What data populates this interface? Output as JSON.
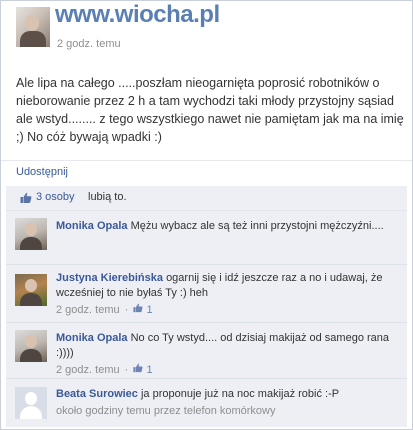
{
  "post": {
    "author": "",
    "time": "2 godz. temu",
    "text": "Ale lipa na całego .....poszłam nieogarnięta poprosić robotników o nieborowanie przez 2 h a tam wychodzi taki młody przystojny sąsiad ale wstyd........ z tego wszystkiego nawet nie pamiętam jak ma na imię ;) No cóż bywają wpadki :)",
    "share_label": "Udostępnij",
    "watermark": "www.wiocha.pl"
  },
  "likes": {
    "icon": "thumbs-up-icon",
    "count_label": "3 osoby",
    "suffix": "lubią to."
  },
  "comments": [
    {
      "author": "Monika Opala",
      "text": "Mężu wybacz ale są też inni przystojni mężczyźni....",
      "time": "",
      "likes": ""
    },
    {
      "author": "Justyna Kierebińska",
      "text": "ogarnij się i idź jeszcze raz a no i udawaj, że wcześniej to nie byłaś Ty :) heh",
      "time": "2 godz. temu",
      "likes": "1"
    },
    {
      "author": "Monika Opala",
      "text": "No co Ty wstyd.... od dzisiaj makijaż od samego rana :))))",
      "time": "2 godz. temu",
      "likes": "1"
    },
    {
      "author": "Beata Surowiec",
      "text": "ja proponuje już na noc makijaż robić :-P",
      "time": "około godziny temu przez telefon komórkowy",
      "likes": ""
    }
  ]
}
